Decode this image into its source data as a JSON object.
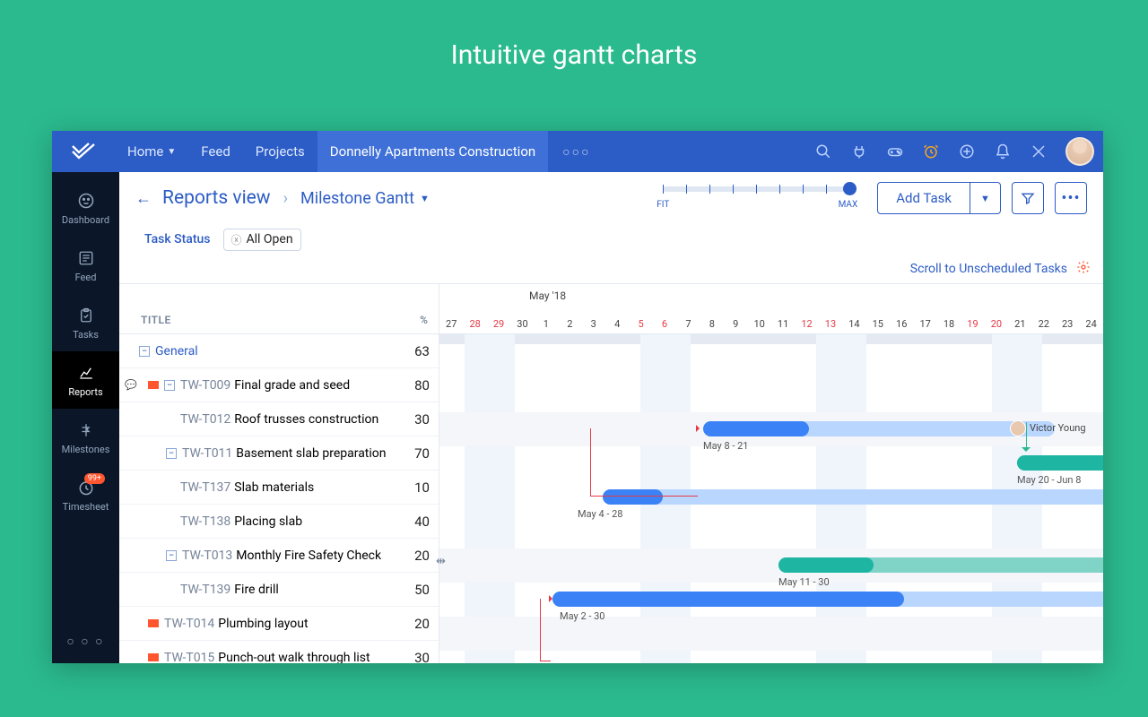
{
  "headline": "Intuitive gantt charts",
  "topnav": {
    "home": "Home",
    "feed": "Feed",
    "projects": "Projects",
    "active": "Donnelly Apartments Construction"
  },
  "rail": {
    "dashboard": "Dashboard",
    "feed": "Feed",
    "tasks": "Tasks",
    "reports": "Reports",
    "milestones": "Milestones",
    "timesheet": "Timesheet",
    "badge": "99+"
  },
  "toolbar": {
    "back_title": "Reports view",
    "view": "Milestone Gantt",
    "zoom_fit": "FIT",
    "zoom_max": "MAX",
    "add_task": "Add Task"
  },
  "filterbar": {
    "task_status": "Task Status",
    "all_open": "All Open"
  },
  "scrollhint": "Scroll to Unscheduled Tasks",
  "list": {
    "th_title": "TITLE",
    "th_pct": "%",
    "rows": [
      {
        "type": "group",
        "general": true,
        "box": "-",
        "name": "General",
        "pct": "63"
      },
      {
        "comment": true,
        "flag": true,
        "box": "-",
        "tw": "TW-T009",
        "name": "Final grade and seed",
        "pct": "80",
        "indent": 10
      },
      {
        "tw": "TW-T012",
        "name": "Roof trusses construction",
        "pct": "30",
        "indent": 46
      },
      {
        "box": "-",
        "tw": "TW-T011",
        "name": "Basement slab preparation",
        "pct": "70",
        "indent": 30
      },
      {
        "tw": "TW-T137",
        "name": "Slab materials",
        "pct": "10",
        "indent": 46
      },
      {
        "tw": "TW-T138",
        "name": "Placing slab",
        "pct": "40",
        "indent": 46
      },
      {
        "box": "-",
        "tw": "TW-T013",
        "name": "Monthly Fire Safety Check",
        "pct": "20",
        "indent": 30
      },
      {
        "tw": "TW-T139",
        "name": "Fire drill",
        "pct": "50",
        "indent": 46
      },
      {
        "flag": true,
        "tw": "TW-T014",
        "name": "Plumbing layout",
        "pct": "20",
        "indent": 10
      },
      {
        "flag": true,
        "tw": "TW-T015",
        "name": "Punch-out walk through list",
        "pct": "30",
        "indent": 10
      }
    ]
  },
  "timeline": {
    "month": "May '18",
    "days": [
      {
        "n": "27"
      },
      {
        "n": "28",
        "w": true
      },
      {
        "n": "29",
        "w": true
      },
      {
        "n": "30"
      },
      {
        "n": "1"
      },
      {
        "n": "2"
      },
      {
        "n": "3"
      },
      {
        "n": "4"
      },
      {
        "n": "5",
        "w": true
      },
      {
        "n": "6",
        "w": true
      },
      {
        "n": "7"
      },
      {
        "n": "8"
      },
      {
        "n": "9"
      },
      {
        "n": "10"
      },
      {
        "n": "11"
      },
      {
        "n": "12",
        "w": true
      },
      {
        "n": "13",
        "w": true
      },
      {
        "n": "14"
      },
      {
        "n": "15"
      },
      {
        "n": "16"
      },
      {
        "n": "17"
      },
      {
        "n": "18"
      },
      {
        "n": "19",
        "w": true
      },
      {
        "n": "20",
        "w": true
      },
      {
        "n": "21"
      },
      {
        "n": "22"
      },
      {
        "n": "23"
      },
      {
        "n": "24"
      }
    ],
    "bars": {
      "t012": "May 8 - 21",
      "t011": "May 20 - Jun 8",
      "t137": "May 4 - 28",
      "t013": "May 11 - 30",
      "t139": "May 2 - 30"
    },
    "victor": "Victor Young"
  },
  "chart_data": {
    "type": "gantt",
    "title": "Milestone Gantt",
    "x_axis": {
      "unit": "day",
      "start": "2018-04-27",
      "end": "2018-05-24",
      "month_label": "May '18"
    },
    "tasks": [
      {
        "id": "General",
        "name": "General",
        "pct": 63,
        "is_group": true
      },
      {
        "id": "TW-T009",
        "name": "Final grade and seed",
        "pct": 80
      },
      {
        "id": "TW-T012",
        "name": "Roof trusses construction",
        "pct": 30,
        "start": "2018-05-08",
        "end": "2018-05-21",
        "assignee": "Victor Young"
      },
      {
        "id": "TW-T011",
        "name": "Basement slab preparation",
        "pct": 70,
        "start": "2018-05-20",
        "end": "2018-06-08"
      },
      {
        "id": "TW-T137",
        "name": "Slab materials",
        "pct": 10,
        "start": "2018-05-04",
        "end": "2018-05-28"
      },
      {
        "id": "TW-T138",
        "name": "Placing slab",
        "pct": 40
      },
      {
        "id": "TW-T013",
        "name": "Monthly Fire Safety Check",
        "pct": 20,
        "start": "2018-05-11",
        "end": "2018-05-30"
      },
      {
        "id": "TW-T139",
        "name": "Fire drill",
        "pct": 50,
        "start": "2018-05-02",
        "end": "2018-05-30"
      },
      {
        "id": "TW-T014",
        "name": "Plumbing layout",
        "pct": 20
      },
      {
        "id": "TW-T015",
        "name": "Punch-out walk through list",
        "pct": 30
      }
    ],
    "dependencies": [
      {
        "from": "TW-T137",
        "to": "TW-T012"
      },
      {
        "from": "TW-T139",
        "to": "TW-T014"
      }
    ]
  }
}
